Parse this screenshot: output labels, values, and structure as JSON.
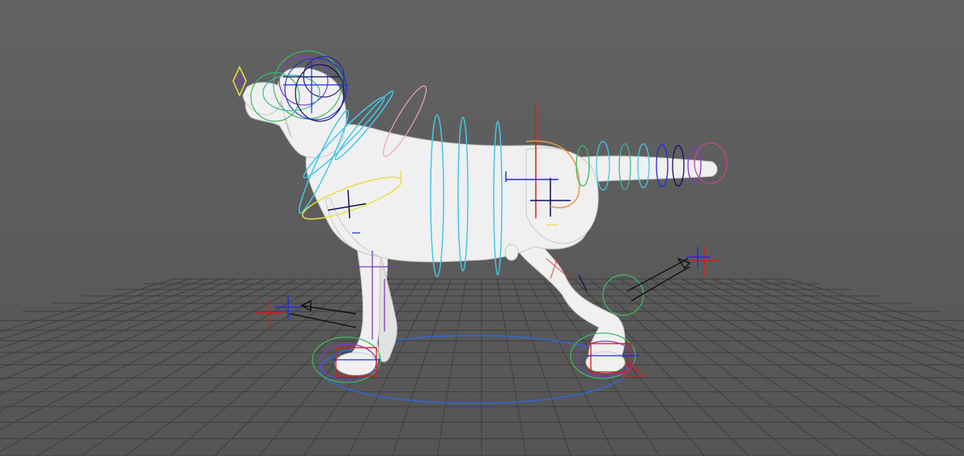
{
  "viewport": {
    "label": "",
    "colors": {
      "background": "#5c5c5c",
      "grid": "#3c3c3c",
      "model": "#f2f2f2",
      "control_cyan": "#44c8ea",
      "control_green": "#3fb85f",
      "control_purple": "#7a3ec0",
      "control_blue": "#1a2ee0",
      "control_red": "#e01818",
      "control_yellow": "#e8e040",
      "control_orange": "#e89a40",
      "root_circle": "#2f67d8"
    },
    "controls": [
      "head-control",
      "nose-control",
      "neck-control",
      "spine-control",
      "shoulder-control",
      "hip-control",
      "tail-control",
      "front-left-foot-ik",
      "back-left-foot-ik",
      "front-pole-vector",
      "back-pole-vector",
      "root-control"
    ]
  }
}
